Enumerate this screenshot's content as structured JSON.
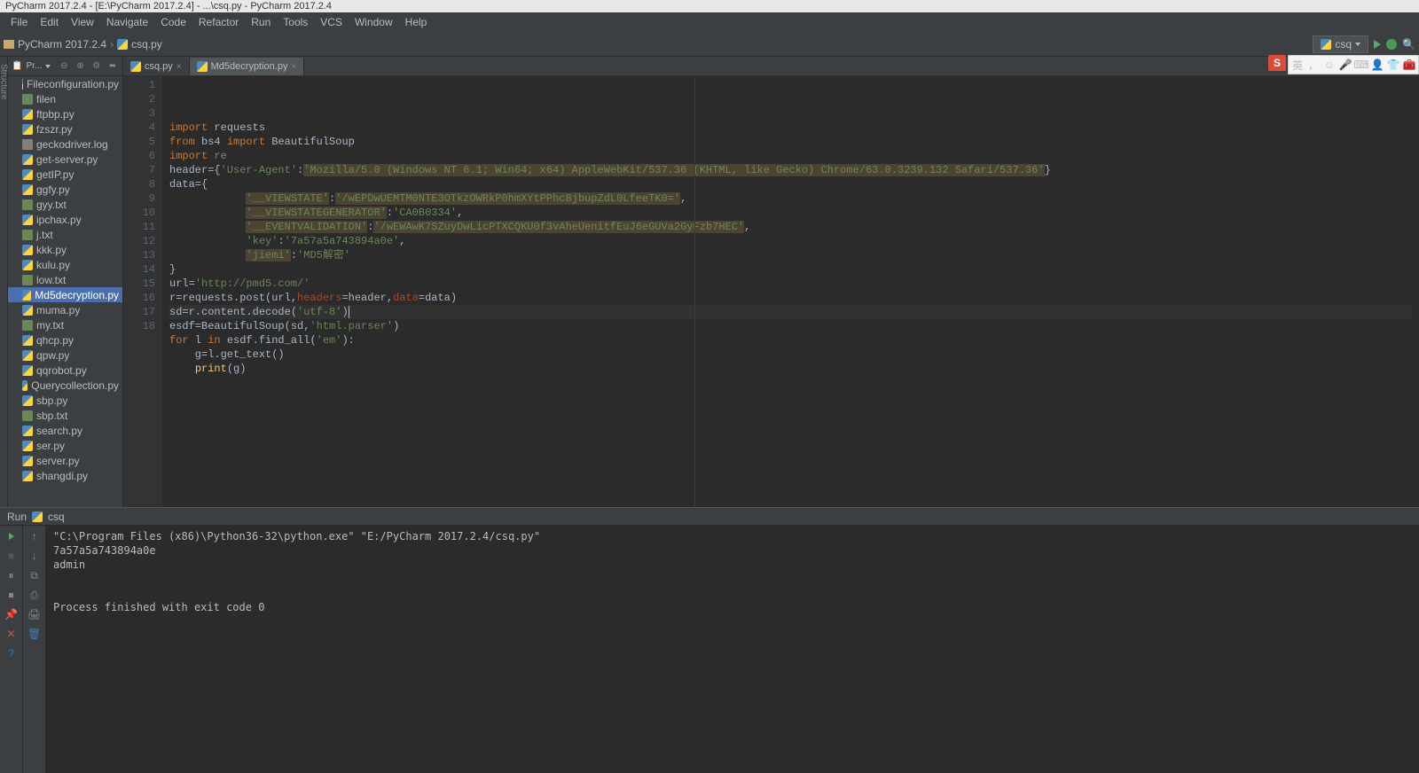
{
  "title_bar": "PyCharm 2017.2.4 - [E:\\PyCharm 2017.2.4] - ...\\csq.py - PyCharm 2017.2.4",
  "menu": {
    "file": "File",
    "edit": "Edit",
    "view": "View",
    "navigate": "Navigate",
    "code": "Code",
    "refactor": "Refactor",
    "run": "Run",
    "tools": "Tools",
    "vcs": "VCS",
    "window": "Window",
    "help": "Help"
  },
  "nav": {
    "project": "PyCharm 2017.2.4",
    "file": "csq.py"
  },
  "run_config": {
    "label": "csq"
  },
  "project_tool": {
    "title": "Pr..."
  },
  "files": [
    {
      "name": "Fileconfiguration.py",
      "type": "py"
    },
    {
      "name": "filen",
      "type": "txt"
    },
    {
      "name": "ftpbp.py",
      "type": "py"
    },
    {
      "name": "fzszr.py",
      "type": "py"
    },
    {
      "name": "geckodriver.log",
      "type": "log"
    },
    {
      "name": "get-server.py",
      "type": "py"
    },
    {
      "name": "getIP.py",
      "type": "py"
    },
    {
      "name": "ggfy.py",
      "type": "py"
    },
    {
      "name": "gyy.txt",
      "type": "txt"
    },
    {
      "name": "ipchax.py",
      "type": "py"
    },
    {
      "name": "j.txt",
      "type": "txt"
    },
    {
      "name": "kkk.py",
      "type": "py"
    },
    {
      "name": "kulu.py",
      "type": "py"
    },
    {
      "name": "low.txt",
      "type": "txt"
    },
    {
      "name": "Md5decryption.py",
      "type": "py",
      "selected": true
    },
    {
      "name": "muma.py",
      "type": "py"
    },
    {
      "name": "my.txt",
      "type": "txt"
    },
    {
      "name": "qhcp.py",
      "type": "py"
    },
    {
      "name": "qpw.py",
      "type": "py"
    },
    {
      "name": "qqrobot.py",
      "type": "py"
    },
    {
      "name": "Querycollection.py",
      "type": "py"
    },
    {
      "name": "sbp.py",
      "type": "py"
    },
    {
      "name": "sbp.txt",
      "type": "txt"
    },
    {
      "name": "search.py",
      "type": "py"
    },
    {
      "name": "ser.py",
      "type": "py"
    },
    {
      "name": "server.py",
      "type": "py"
    },
    {
      "name": "shangdi.py",
      "type": "py"
    }
  ],
  "tabs": [
    {
      "name": "csq.py",
      "active": true
    },
    {
      "name": "Md5decryption.py",
      "active": false
    }
  ],
  "code_lines": [
    {
      "n": 1,
      "html": "<span class='kw'>import</span> requests"
    },
    {
      "n": 2,
      "html": "<span class='kw'>from</span> bs4 <span class='kw'>import</span> BeautifulSoup"
    },
    {
      "n": 3,
      "html": "<span class='kw'>import</span> <span class='comment'>re</span>"
    },
    {
      "n": 4,
      "html": "header={<span class='str'>'User-Agent'</span>:<span class='str-warn'>'Mozilla/5.0 (Windows NT 6.1; Win64; x64) AppleWebKit/537.36 (KHTML, like Gecko) Chrome/63.0.3239.132 Safari/537.36'</span>}"
    },
    {
      "n": 5,
      "html": "data={"
    },
    {
      "n": 6,
      "html": "            <span class='str-warn'>'__VIEWSTATE'</span>:<span class='str-warn'>'/wEPDwUEMTM0NTE3OTkzOWRkP0hmXYtPPhcBjbupZdL0LfeeTK0='</span>,"
    },
    {
      "n": 7,
      "html": "            <span class='str-warn'>'__VIEWSTATEGENERATOR'</span>:<span class='str'>'CA0B0334'</span>,"
    },
    {
      "n": 8,
      "html": "            <span class='str-warn'>'__EVENTVALIDATION'</span>:<span class='str-warn'>'/wEWAwK7SZuyDwLicPTXCQKU0f3vAheUenitfEuJ6eGUVa2GyFzb7HEC'</span>,"
    },
    {
      "n": 9,
      "html": "            <span class='str'>'key'</span>:<span class='str'>'7a57a5a743894a0e'</span>,"
    },
    {
      "n": 10,
      "html": "            <span class='str-warn'>'jiemi'</span>:<span class='str'>'MD5解密'</span>"
    },
    {
      "n": 11,
      "html": "}"
    },
    {
      "n": 12,
      "html": "url=<span class='str'>'http://pmd5.com/'</span>"
    },
    {
      "n": 13,
      "html": "r=requests.post(url,<span class='param'>headers</span>=header,<span class='param'>data</span>=data)"
    },
    {
      "n": 14,
      "html": "sd=r.content.decode(<span class='str'>'utf-8'</span>)<span class='caret'></span>",
      "current": true
    },
    {
      "n": 15,
      "html": "esdf=BeautifulSoup(sd,<span class='str'>'html.parser'</span>)"
    },
    {
      "n": 16,
      "html": "<span class='kw'>for</span> l <span class='kw'>in</span> esdf.find_all(<span class='str'>'em'</span>):"
    },
    {
      "n": 17,
      "html": "    g=l.get_text()"
    },
    {
      "n": 18,
      "html": "    <span class='fn'>print</span>(g)"
    }
  ],
  "run_panel": {
    "title": "Run",
    "config": "csq",
    "output": [
      "\"C:\\Program Files (x86)\\Python36-32\\python.exe\" \"E:/PyCharm 2017.2.4/csq.py\"",
      "7a57a5a743894a0e",
      "admin",
      "",
      "",
      "Process finished with exit code 0"
    ]
  },
  "ime": {
    "badge": "S",
    "lang": "英"
  }
}
